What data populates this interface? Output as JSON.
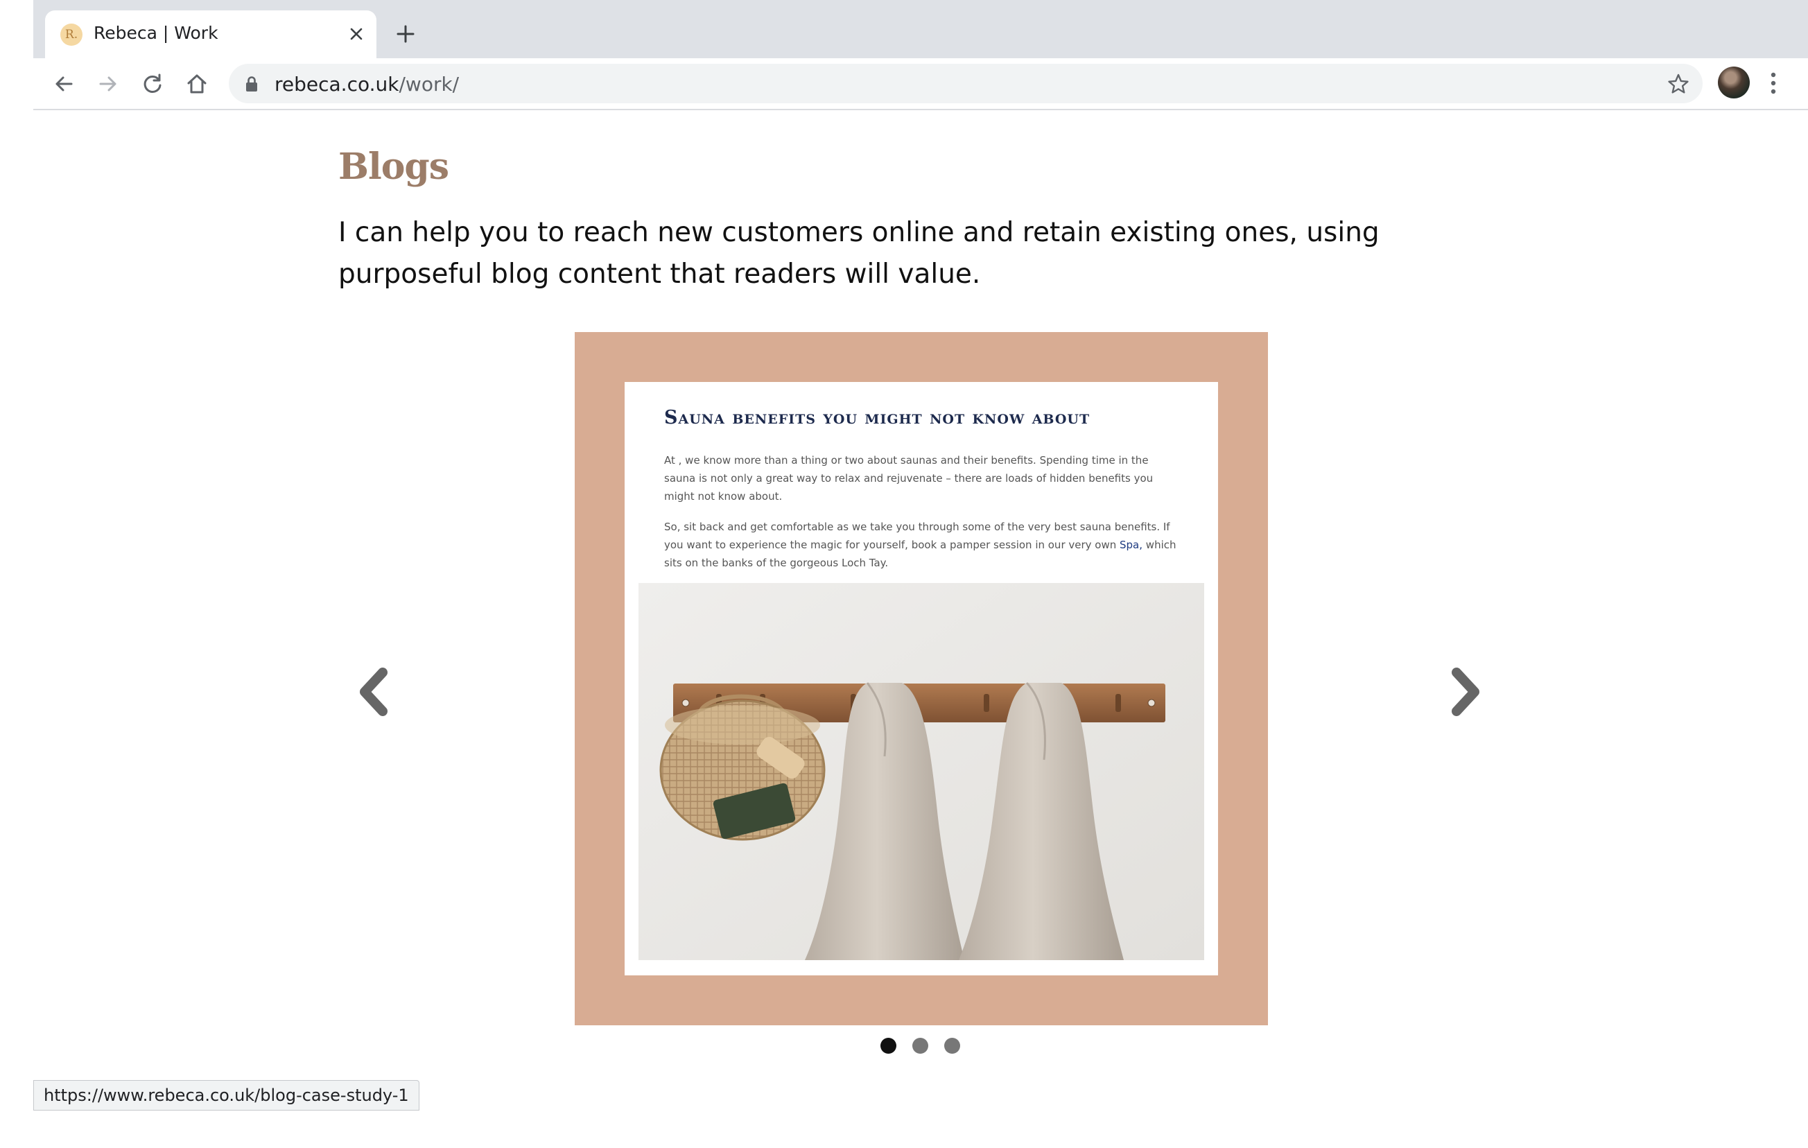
{
  "browser": {
    "tab_title": "Rebeca | Work",
    "favicon_text": "R.",
    "url_host": "rebeca.co.uk",
    "url_path": "/work/",
    "status_url": "https://www.rebeca.co.uk/blog-case-study-1"
  },
  "section": {
    "title": "Blogs",
    "intro": "I can help you to reach new customers online and retain existing ones, using purposeful blog content that readers will value."
  },
  "carousel": {
    "slide": {
      "post_title": "Sauna benefits you might not know about",
      "paragraph_1": "At                        , we know more than a thing or two about saunas and their benefits. Spending time in the sauna is not only a great way to relax and rejuvenate – there are loads of hidden benefits you might not know about.",
      "paragraph_2_text": "So, sit back and get comfortable as we take you through some of the very best sauna benefits. If you want to experience the magic for yourself, book a pamper session in our very own               ",
      "paragraph_2_link": "Spa,",
      "paragraph_2_end": " which sits on the banks of the gorgeous Loch Tay."
    },
    "dots_total": 3,
    "active_index": 0
  },
  "colors": {
    "heading": "#9c7d68",
    "slide_background": "#d8ac93",
    "post_title": "#1d2a4d",
    "link": "#1d3a80",
    "dot_active": "#111111",
    "dot_inactive": "#777777"
  },
  "icons": {
    "back": "back-arrow-icon",
    "forward": "forward-arrow-icon",
    "reload": "reload-icon",
    "home": "home-icon",
    "lock": "lock-icon",
    "bookmark": "star-icon",
    "menu": "kebab-menu-icon",
    "close_tab": "close-icon",
    "new_tab": "plus-icon",
    "previous_slide": "chevron-left-icon",
    "next_slide": "chevron-right-icon"
  }
}
